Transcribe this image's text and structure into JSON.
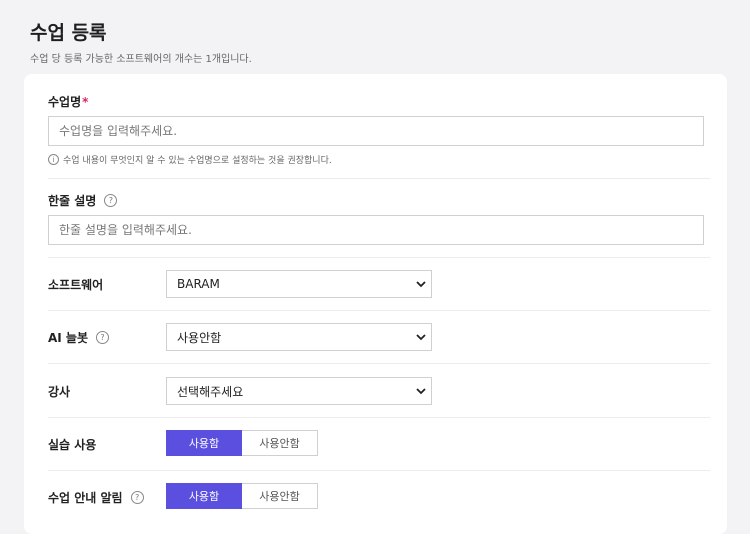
{
  "header": {
    "title": "수업 등록",
    "subtitle": "수업 당 등록 가능한 소프트웨어의 개수는 1개입니다."
  },
  "form": {
    "class_name": {
      "label": "수업명",
      "required_mark": "*",
      "placeholder": "수업명을 입력해주세요.",
      "value": "",
      "hint": "수업 내용이 무엇인지 알 수 있는 수업명으로 설정하는 것을 권장합니다."
    },
    "short_desc": {
      "label": "한줄 설명",
      "placeholder": "한줄 설명을 입력해주세요.",
      "value": ""
    },
    "software": {
      "label": "소프트웨어",
      "selected": "BARAM"
    },
    "ai_notebook": {
      "label": "AI 늘봇",
      "selected": "사용안함"
    },
    "instructor": {
      "label": "강사",
      "selected": "선택해주세요"
    },
    "practice": {
      "label": "실습 사용",
      "on_label": "사용함",
      "off_label": "사용안함",
      "selected": "사용함"
    },
    "notice": {
      "label": "수업 안내 알림",
      "on_label": "사용함",
      "off_label": "사용안함",
      "selected": "사용함"
    }
  },
  "icons": {
    "help": "question-circle-icon",
    "info": "info-circle-icon",
    "dropdown": "chevron-down-icon"
  },
  "colors": {
    "accent": "#5b4fe0",
    "required": "#e0245e",
    "background": "#f3f3f6"
  }
}
